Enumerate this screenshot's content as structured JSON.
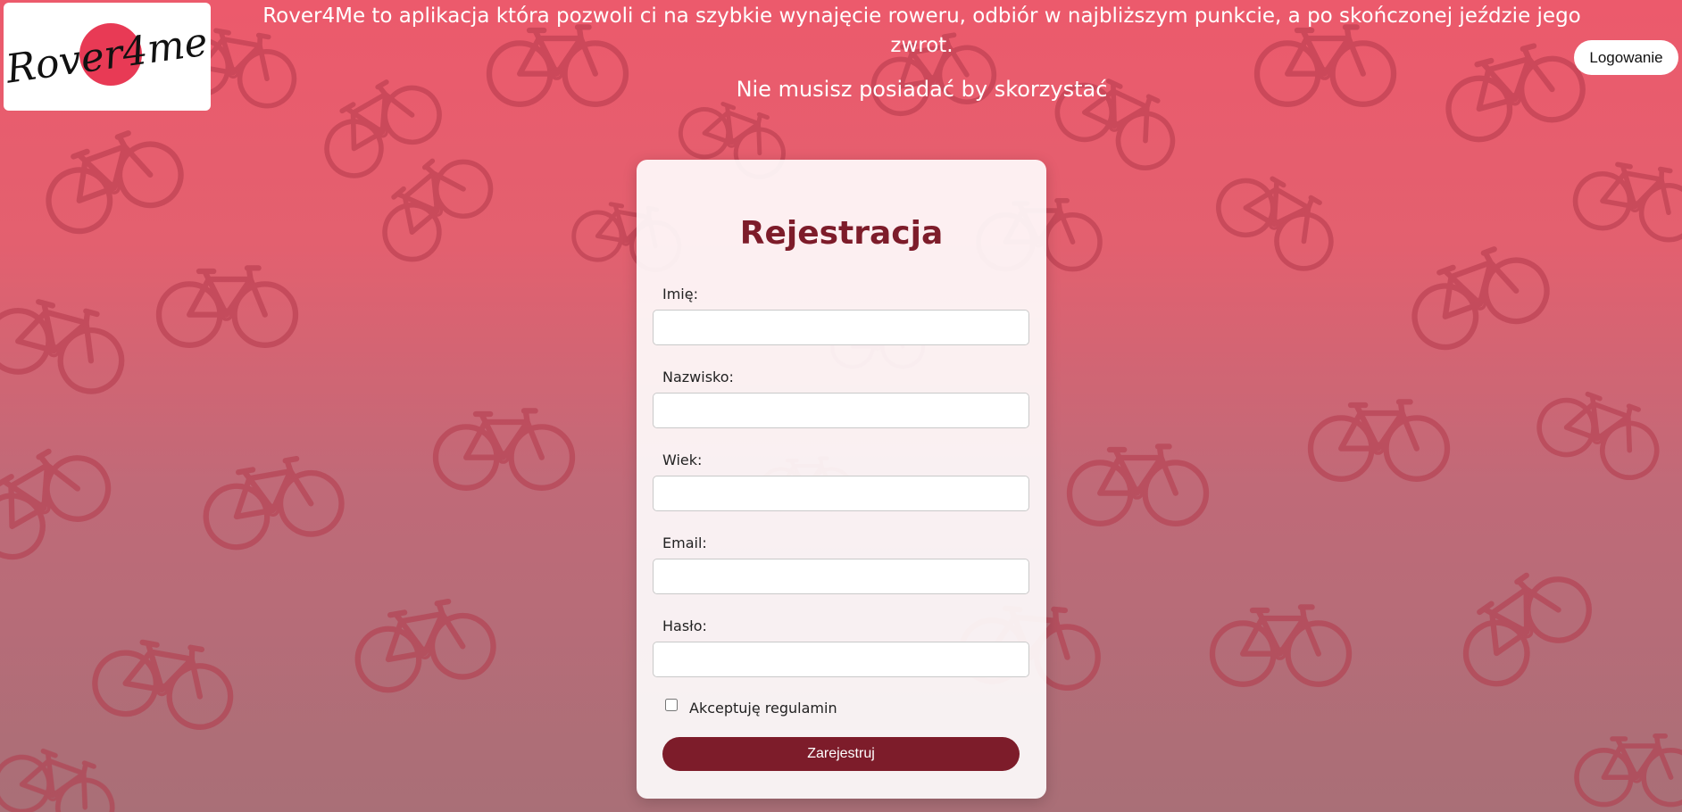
{
  "header": {
    "logo_text": "Rover4me",
    "intro_text": "Rover4Me to aplikacja która pozwoli ci na szybkie wynajęcie roweru, odbiór w najbliższym punkcie, a po skończonej jeździe jego zwrot.",
    "tagline": "Nie musisz posiadać by skorzystać",
    "login_label": "Logowanie"
  },
  "form": {
    "title": "Rejestracja",
    "fields": [
      {
        "label": "Imię:",
        "value": "",
        "placeholder": ""
      },
      {
        "label": "Nazwisko:",
        "value": "",
        "placeholder": ""
      },
      {
        "label": "Wiek:",
        "value": "",
        "placeholder": ""
      },
      {
        "label": "Email:",
        "value": "",
        "placeholder": ""
      },
      {
        "label": "Hasło:",
        "value": "",
        "placeholder": ""
      }
    ],
    "terms_label": "Akceptuję regulamin",
    "terms_checked": false,
    "submit_label": "Zarejestruj"
  },
  "colors": {
    "background_top": "#ec5a6c",
    "background_bottom": "#a96f77",
    "accent": "#7d1c2a",
    "logo_circle": "#e83a55",
    "pattern": "#b23a4b"
  },
  "icons": {
    "background_pattern": "bicycle-icon",
    "logo_mark": "red-circle"
  }
}
